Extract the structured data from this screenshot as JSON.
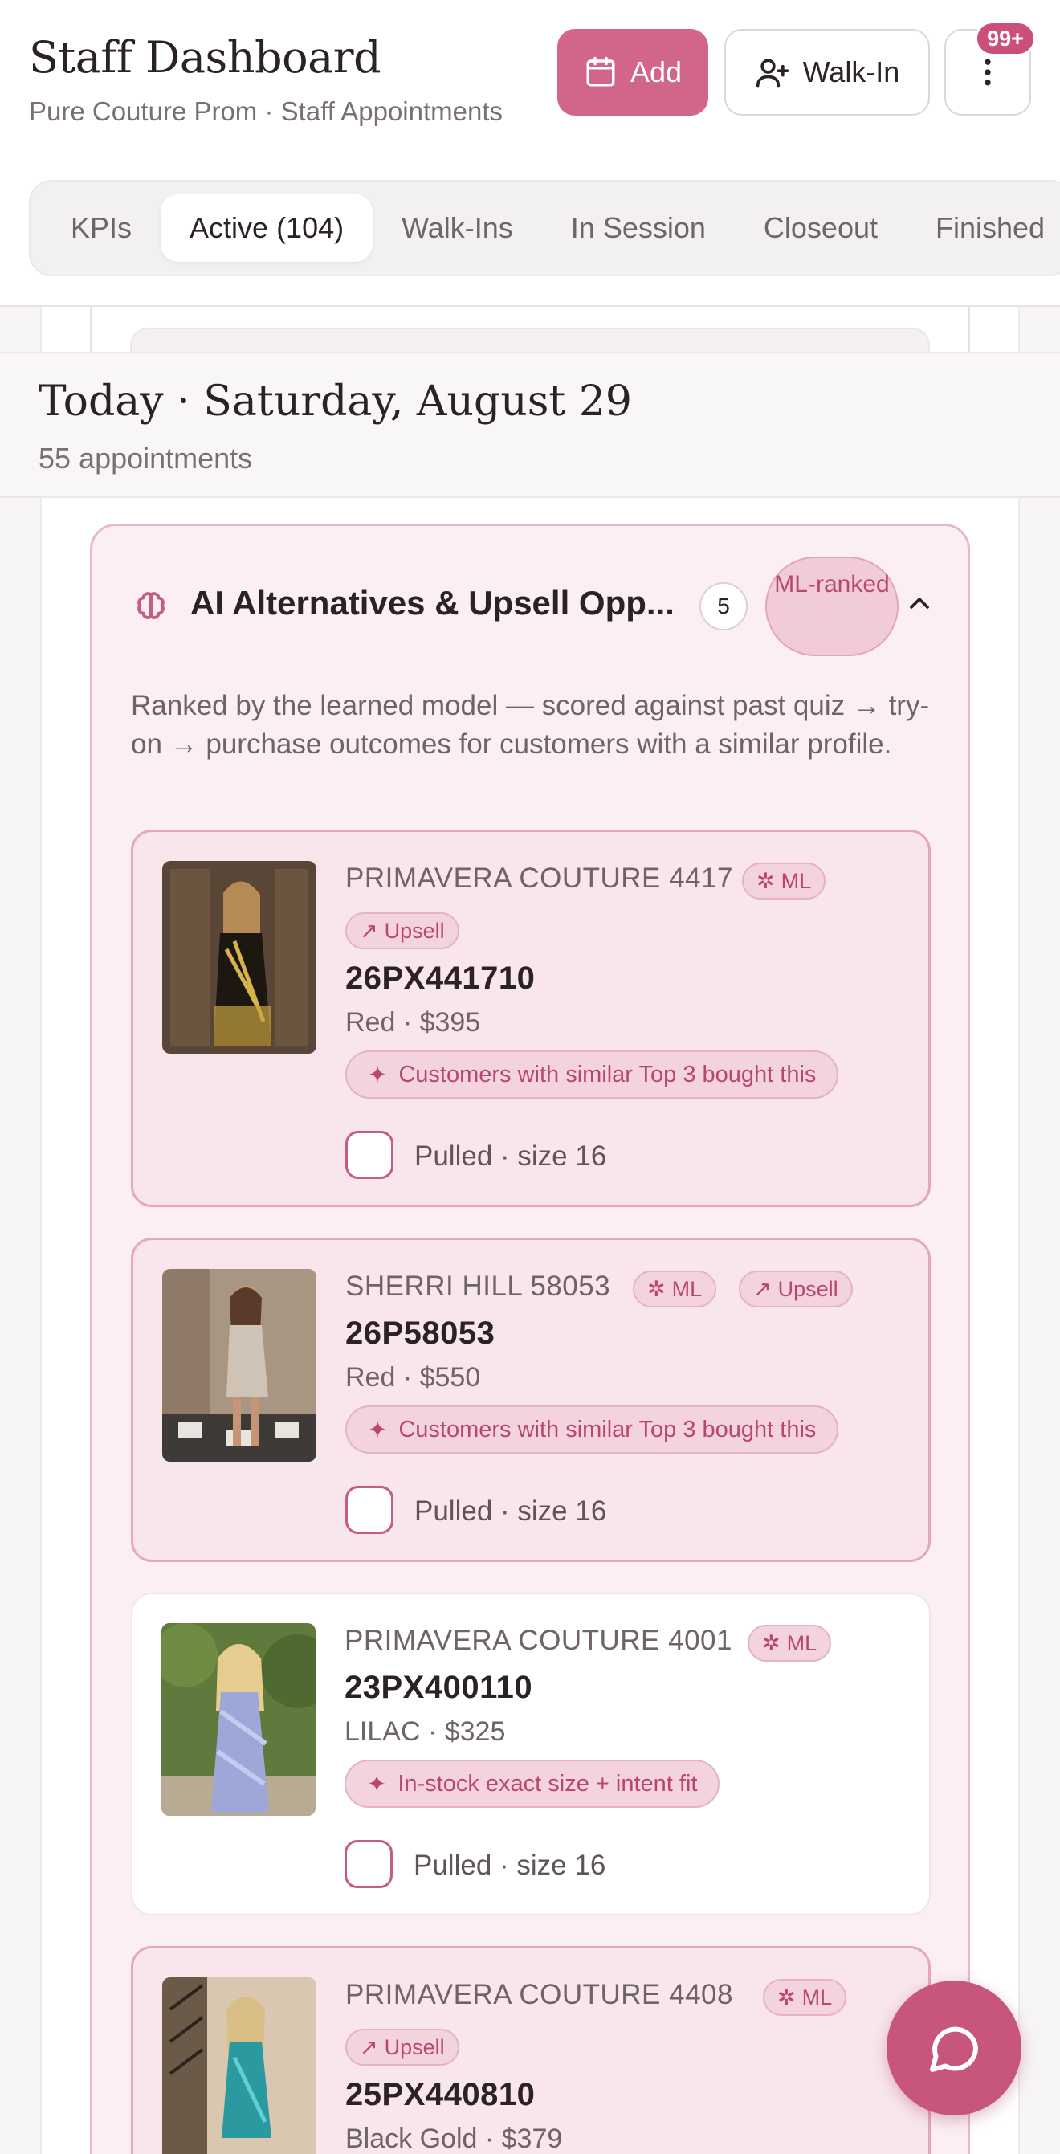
{
  "header": {
    "title": "Staff Dashboard",
    "subtitle": "Pure Couture Prom · Staff Appointments",
    "add_label": "Add",
    "walkin_label": "Walk-In",
    "notification_count": "99+"
  },
  "tabs": [
    {
      "label": "KPIs",
      "active": false
    },
    {
      "label": "Active (104)",
      "active": true
    },
    {
      "label": "Walk-Ins",
      "active": false
    },
    {
      "label": "In Session",
      "active": false
    },
    {
      "label": "Closeout",
      "active": false
    },
    {
      "label": "Finished",
      "active": false
    }
  ],
  "date": {
    "title": "Today · Saturday, August 29",
    "count": "55 appointments"
  },
  "ai_panel": {
    "title": "AI Alternatives & Upsell Opp...",
    "count": "5",
    "ml_ranked": "ML-ranked",
    "description": "Ranked by the learned model — scored against past quiz → try-on → purchase outcomes for customers with a similar profile."
  },
  "products": [
    {
      "brand": "PRIMAVERA COUTURE 4417",
      "ml": "ML",
      "upsell": "Upsell",
      "sku": "26PX441710",
      "meta": "Red · $395",
      "reason": "Customers with similar Top 3 bought this",
      "pulled": "Pulled · size 16",
      "highlight": true
    },
    {
      "brand": "SHERRI HILL 58053",
      "ml": "ML",
      "upsell": "Upsell",
      "sku": "26P58053",
      "meta": "Red · $550",
      "reason": "Customers with similar Top 3 bought this",
      "pulled": "Pulled · size 16",
      "highlight": true
    },
    {
      "brand": "PRIMAVERA COUTURE 4001",
      "ml": "ML",
      "upsell": "",
      "sku": "23PX400110",
      "meta": "LILAC · $325",
      "reason": "In-stock exact size + intent fit",
      "pulled": "Pulled · size 16",
      "highlight": false
    },
    {
      "brand": "PRIMAVERA COUTURE 4408",
      "ml": "ML",
      "upsell": "Upsell",
      "sku": "25PX440810",
      "meta": "Black Gold · $379",
      "reason": "",
      "pulled": "",
      "highlight": true
    }
  ],
  "colors": {
    "accent": "#d1668a",
    "accent_dark": "#c8557c",
    "badge": "#cc4f78"
  },
  "icons": {
    "add": "calendar-icon",
    "walkin": "user-plus-icon",
    "more": "more-vertical-icon",
    "panel": "brain-icon",
    "chat": "chat-bubble-icon"
  }
}
